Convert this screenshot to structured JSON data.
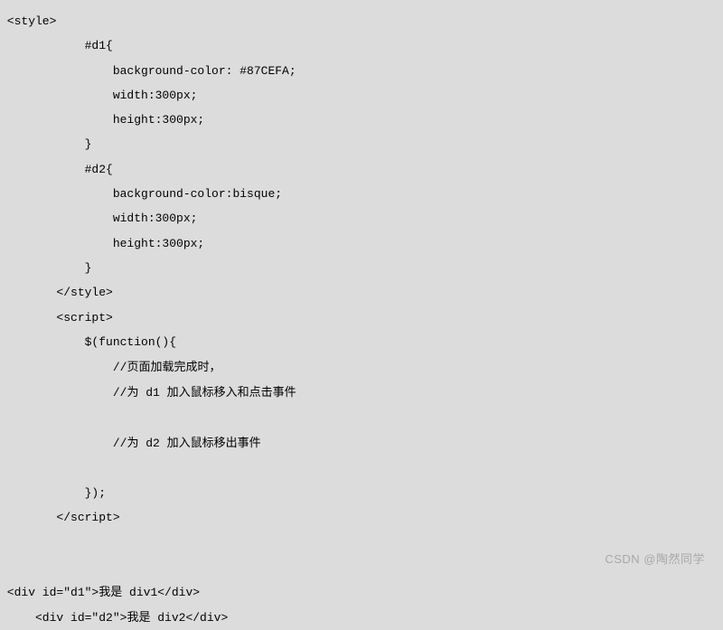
{
  "code": {
    "lines": [
      {
        "indent": " ",
        "text": "<style>"
      },
      {
        "indent": "            ",
        "text": "#d1{"
      },
      {
        "indent": "                ",
        "text": "background-color: #87CEFA;"
      },
      {
        "indent": "                ",
        "text": "width:300px;"
      },
      {
        "indent": "                ",
        "text": "height:300px;"
      },
      {
        "indent": "            ",
        "text": "}"
      },
      {
        "indent": "            ",
        "text": "#d2{"
      },
      {
        "indent": "                ",
        "text": "background-color:bisque;"
      },
      {
        "indent": "                ",
        "text": "width:300px;"
      },
      {
        "indent": "                ",
        "text": "height:300px;"
      },
      {
        "indent": "            ",
        "text": "}"
      },
      {
        "indent": "        ",
        "text": "</style>"
      },
      {
        "indent": "        ",
        "text": "<script>"
      },
      {
        "indent": "            ",
        "text": "$(function(){"
      },
      {
        "indent": "                ",
        "text": "//页面加载完成时，"
      },
      {
        "indent": "                ",
        "text": "//为 d1 加入鼠标移入和点击事件"
      },
      {
        "indent": "",
        "text": ""
      },
      {
        "indent": "                ",
        "text": "//为 d2 加入鼠标移出事件"
      },
      {
        "indent": "",
        "text": ""
      },
      {
        "indent": "            ",
        "text": "});"
      },
      {
        "indent": "        ",
        "text": "</script>"
      },
      {
        "indent": "",
        "text": ""
      },
      {
        "indent": "",
        "text": ""
      },
      {
        "indent": " ",
        "text": "<div id=\"d1\">我是 div1</div>"
      },
      {
        "indent": "     ",
        "text": "<div id=\"d2\">我是 div2</div>"
      }
    ]
  },
  "watermark": "CSDN @陶然同学"
}
